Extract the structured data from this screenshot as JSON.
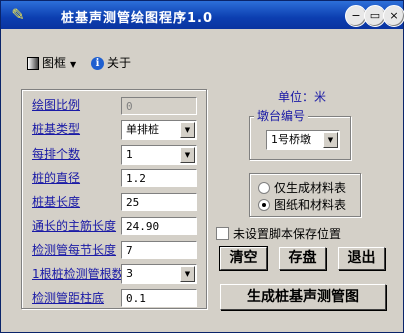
{
  "window": {
    "title": "桩基声测管绘图程序1.0",
    "minimize_label": "−",
    "restore_label": "▭",
    "close_label": "×"
  },
  "menu": {
    "frame_label": "图框",
    "about_label": "关于"
  },
  "params": [
    {
      "label": "绘图比例",
      "value": "0",
      "kind": "field-disabled"
    },
    {
      "label": "桩基类型",
      "value": "单排桩",
      "kind": "combo"
    },
    {
      "label": "每排个数",
      "value": "1",
      "kind": "combo"
    },
    {
      "label": "桩的直径",
      "value": "1.2",
      "kind": "field"
    },
    {
      "label": "桩基长度",
      "value": "25",
      "kind": "field"
    },
    {
      "label": "通长的主筋长度",
      "value": "24.90",
      "kind": "field"
    },
    {
      "label": "检测管每节长度",
      "value": "7",
      "kind": "field"
    },
    {
      "label": "1根桩检测管根数",
      "value": "3",
      "kind": "combo"
    },
    {
      "label": "检测管距柱底",
      "value": "0.1",
      "kind": "field"
    }
  ],
  "unit_text": "单位：米",
  "pier": {
    "group_title": "墩台编号",
    "selected": "1号桥墩"
  },
  "output": {
    "options": [
      "仅生成材料表",
      "图纸和材料表"
    ],
    "selected_index": 1
  },
  "no_script_checkbox": {
    "label": "未设置脚本保存位置",
    "checked": false
  },
  "buttons": {
    "clear": "清空",
    "save": "存盘",
    "exit": "退出",
    "generate": "生成桩基声测管图"
  },
  "colors": {
    "title_bar": "#0c3eb0",
    "label_blue": "#1a1aa6",
    "face": "#d4d0c8"
  }
}
